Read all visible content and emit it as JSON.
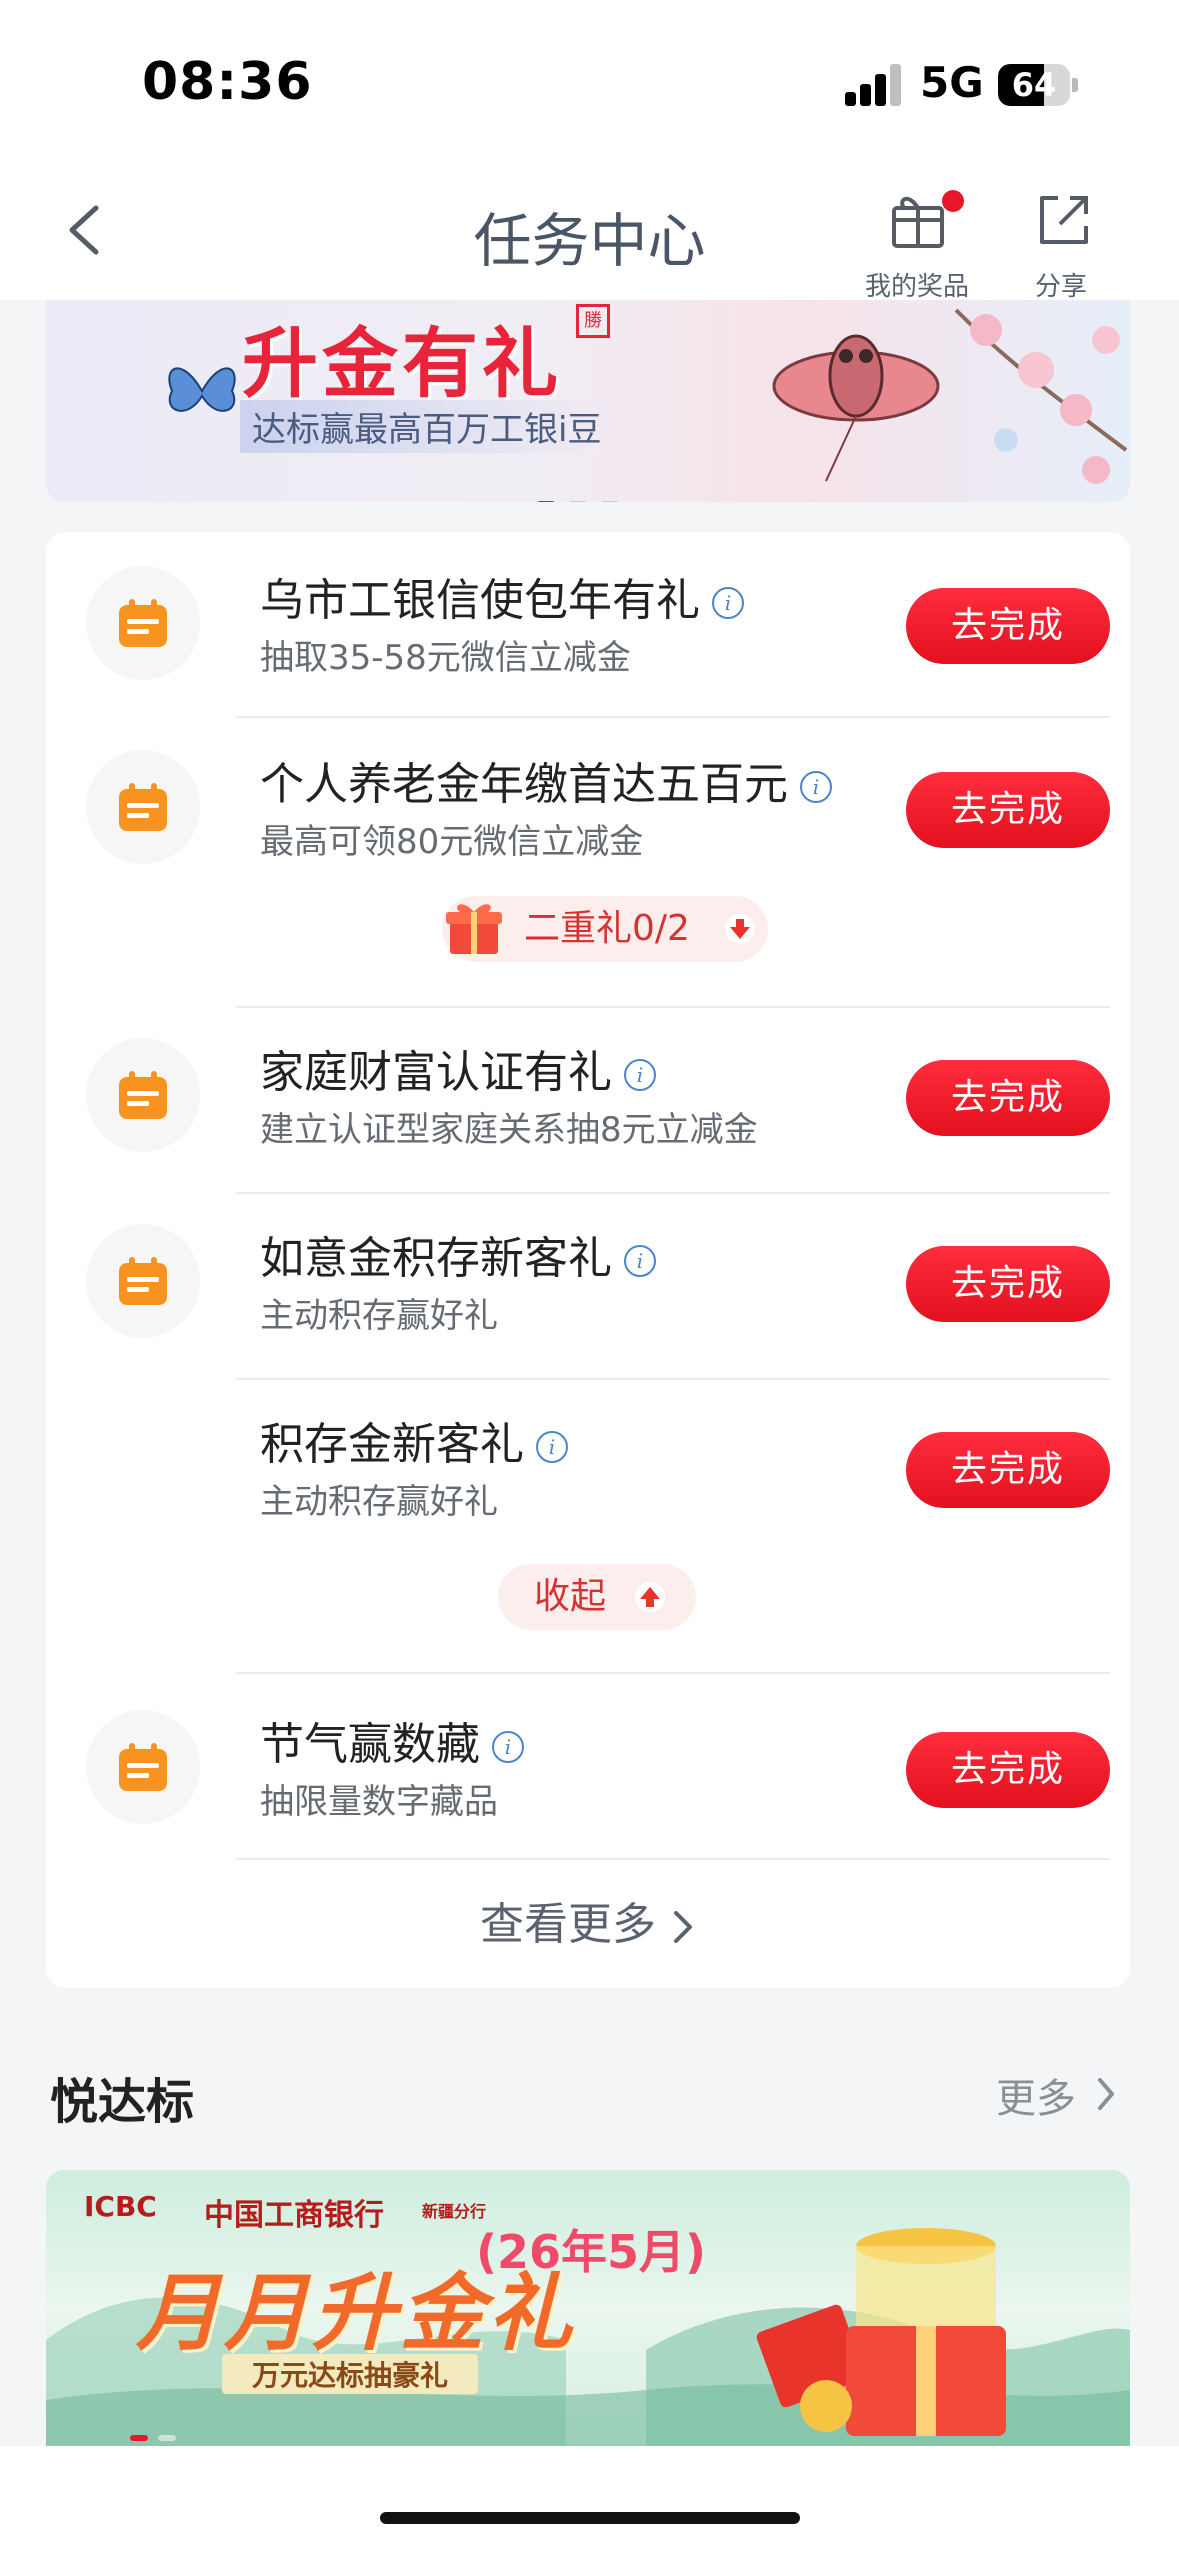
{
  "status": {
    "time": "08:36",
    "network": "5G",
    "battery": "64",
    "battery_level": 0.64
  },
  "nav": {
    "title": "任务中心",
    "prizes_label": "我的奖品",
    "share_label": "分享"
  },
  "banner": {
    "title": "升金有礼",
    "subtitle": "达标赢最高百万工银i豆",
    "stamp": "勝",
    "slides": 3,
    "active_slide": 0
  },
  "tasks": [
    {
      "title": "乌市工银信使包年有礼",
      "desc": "抽取35-58元微信立减金",
      "button": "去完成",
      "info": "i"
    },
    {
      "title": "个人养老金年缴首达五百元",
      "desc": "最高可领80元微信立减金",
      "button": "去完成",
      "info": "i"
    },
    {
      "title": "家庭财富认证有礼",
      "desc": "建立认证型家庭关系抽8元立减金",
      "button": "去完成",
      "info": "i"
    },
    {
      "title": "如意金积存新客礼",
      "desc": "主动积存赢好礼",
      "button": "去完成",
      "info": "i"
    },
    {
      "title": "积存金新客礼",
      "desc": "主动积存赢好礼",
      "button": "去完成",
      "info": "i"
    },
    {
      "title": "节气赢数藏",
      "desc": "抽限量数字藏品",
      "button": "去完成",
      "info": "i"
    }
  ],
  "second_gift": {
    "label": "二重礼0/2"
  },
  "collapse": {
    "label": "收起"
  },
  "view_more": {
    "label": "查看更多"
  },
  "section": {
    "title": "悦达标",
    "more": "更多"
  },
  "promo": {
    "logo": "ICBC",
    "bank_name": "中国工商银行",
    "branch": "新疆分行",
    "title": "月月升金礼",
    "month": "(26年5月)",
    "subtitle": "万元达标抽豪礼",
    "slides": 2,
    "active_slide": 0
  },
  "colors": {
    "accent_red": "#e8172c",
    "icon_orange": "#f7931e",
    "info_blue": "#4a86c8"
  }
}
